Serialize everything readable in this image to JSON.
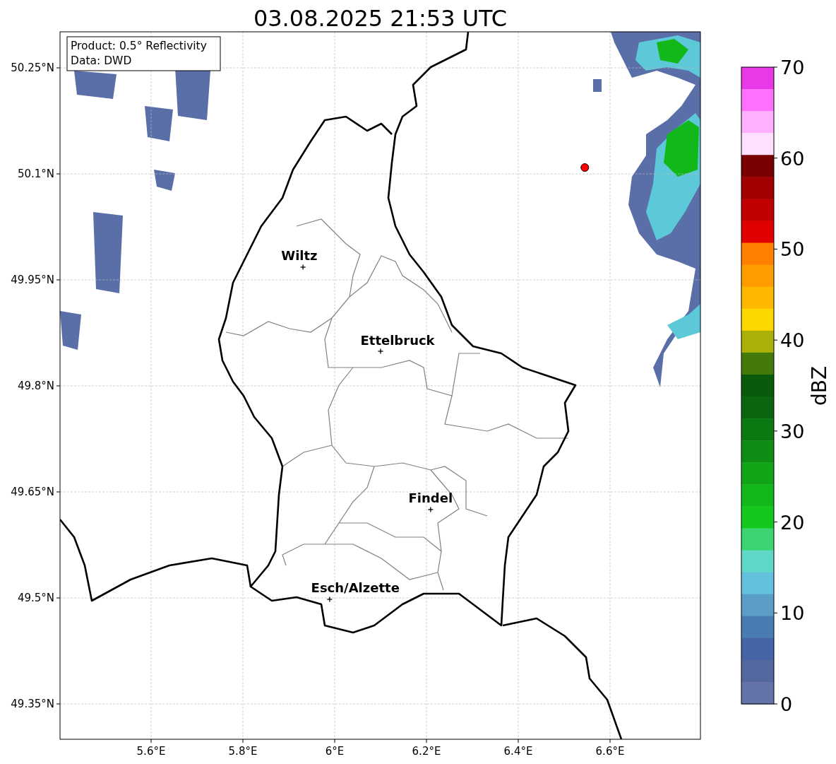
{
  "map": {
    "title": "03.08.2025 21:53 UTC",
    "lon_ticks": [
      "5.6°E",
      "5.8°E",
      "6°E",
      "6.2°E",
      "6.4°E",
      "6.6°E"
    ],
    "lat_ticks": [
      "50.25°N",
      "50.1°N",
      "49.95°N",
      "49.8°N",
      "49.65°N",
      "49.5°N",
      "49.35°N"
    ],
    "cities": [
      {
        "name": "Wiltz"
      },
      {
        "name": "Ettelbruck"
      },
      {
        "name": "Findel"
      },
      {
        "name": "Esch/Alzette"
      }
    ]
  },
  "info_box": [
    "Product: 0.5° Reflectivity",
    "Data: DWD"
  ],
  "colorbar": {
    "label": "dBZ",
    "ticks": [
      "70",
      "60",
      "50",
      "40",
      "30",
      "20",
      "10",
      "0"
    ],
    "bins": [
      {
        "color": "#e838e8"
      },
      {
        "color": "#ff70ff"
      },
      {
        "color": "#ffb0ff"
      },
      {
        "color": "#ffe0ff"
      },
      {
        "color": "#780000"
      },
      {
        "color": "#a00000"
      },
      {
        "color": "#c00000"
      },
      {
        "color": "#e00000"
      },
      {
        "color": "#ff8000"
      },
      {
        "color": "#ff9c00"
      },
      {
        "color": "#ffb800"
      },
      {
        "color": "#ffd700"
      },
      {
        "color": "#aab008"
      },
      {
        "color": "#447a0a"
      },
      {
        "color": "#0a5a0c"
      },
      {
        "color": "#0a6410"
      },
      {
        "color": "#0c7812"
      },
      {
        "color": "#0e8c14"
      },
      {
        "color": "#10a416"
      },
      {
        "color": "#12b81a"
      },
      {
        "color": "#14c81c"
      },
      {
        "color": "#3cd470"
      },
      {
        "color": "#60d8c8"
      },
      {
        "color": "#64c0dc"
      },
      {
        "color": "#5a9ec8"
      },
      {
        "color": "#4a7cb4"
      },
      {
        "color": "#4664a8"
      },
      {
        "color": "#5468a0"
      },
      {
        "color": "#6474a8"
      }
    ]
  }
}
